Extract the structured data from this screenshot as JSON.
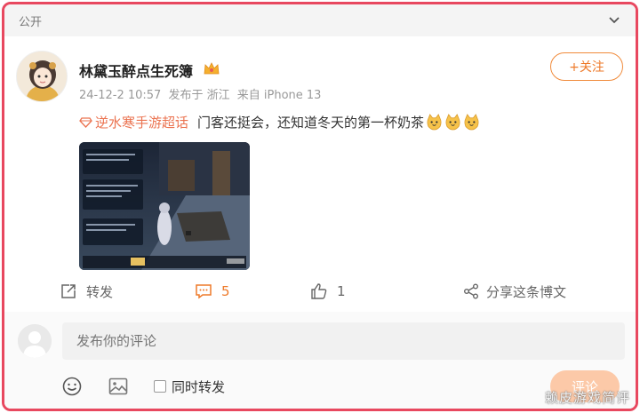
{
  "topbar": {
    "visibility": "公开"
  },
  "post": {
    "author": "林黛玉醉点生死簿",
    "meta": {
      "time": "24-12-2 10:57",
      "from_label": "发布于 浙江",
      "device": "来自 iPhone 13"
    },
    "follow_label": "+关注",
    "topic": "逆水寒手游超话",
    "text": "门客还挺会，还知道冬天的第一杯奶茶"
  },
  "actions": {
    "repost": "转发",
    "comment_count": "5",
    "like_count": "1",
    "share": "分享这条博文"
  },
  "composer": {
    "placeholder": "发布你的评论",
    "repost_checkbox": "同时转发",
    "submit": "评论"
  },
  "watermark": "赖皮游戏简评",
  "colors": {
    "accent": "#ee7a2a",
    "frame": "#e8485f",
    "topic": "#eb7350"
  }
}
